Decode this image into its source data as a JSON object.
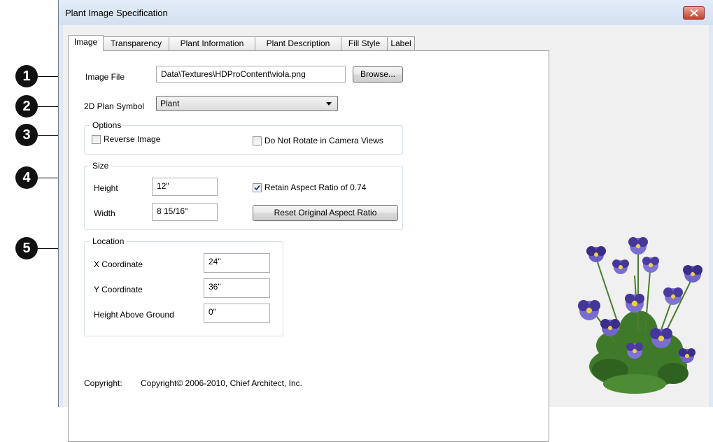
{
  "window": {
    "title": "Plant Image Specification"
  },
  "tabs": [
    {
      "label": "Image",
      "active": true
    },
    {
      "label": "Transparency"
    },
    {
      "label": "Plant Information"
    },
    {
      "label": "Plant Description"
    },
    {
      "label": "Fill Style"
    },
    {
      "label": "Label"
    }
  ],
  "callouts": [
    "1",
    "2",
    "3",
    "4",
    "5"
  ],
  "image_file": {
    "label": "Image File",
    "value": "Data\\Textures\\HDProContent\\viola.png",
    "browse_label": "Browse..."
  },
  "plan_symbol": {
    "label": "2D Plan Symbol",
    "selected": "Plant"
  },
  "options": {
    "title": "Options",
    "reverse_image": {
      "label": "Reverse Image",
      "checked": false
    },
    "do_not_rotate": {
      "label": "Do Not Rotate in Camera Views",
      "checked": false
    }
  },
  "size": {
    "title": "Size",
    "height_label": "Height",
    "height_value": "12\"",
    "width_label": "Width",
    "width_value": "8 15/16\"",
    "retain_label": "Retain Aspect Ratio of 0.74",
    "retain_checked": true,
    "reset_label": "Reset Original Aspect Ratio"
  },
  "location": {
    "title": "Location",
    "x_label": "X Coordinate",
    "x_value": "24\"",
    "y_label": "Y Coordinate",
    "y_value": "36\"",
    "h_label": "Height Above Ground",
    "h_value": "0\""
  },
  "copyright": {
    "label": "Copyright:",
    "value": "Copyright© 2006-2010, Chief Architect, Inc."
  },
  "preview": {
    "icon": "viola-plant-image"
  },
  "colors": {
    "petal": "#7a6fd0",
    "leaf": "#3f7a2a",
    "close": "#c7402c"
  }
}
